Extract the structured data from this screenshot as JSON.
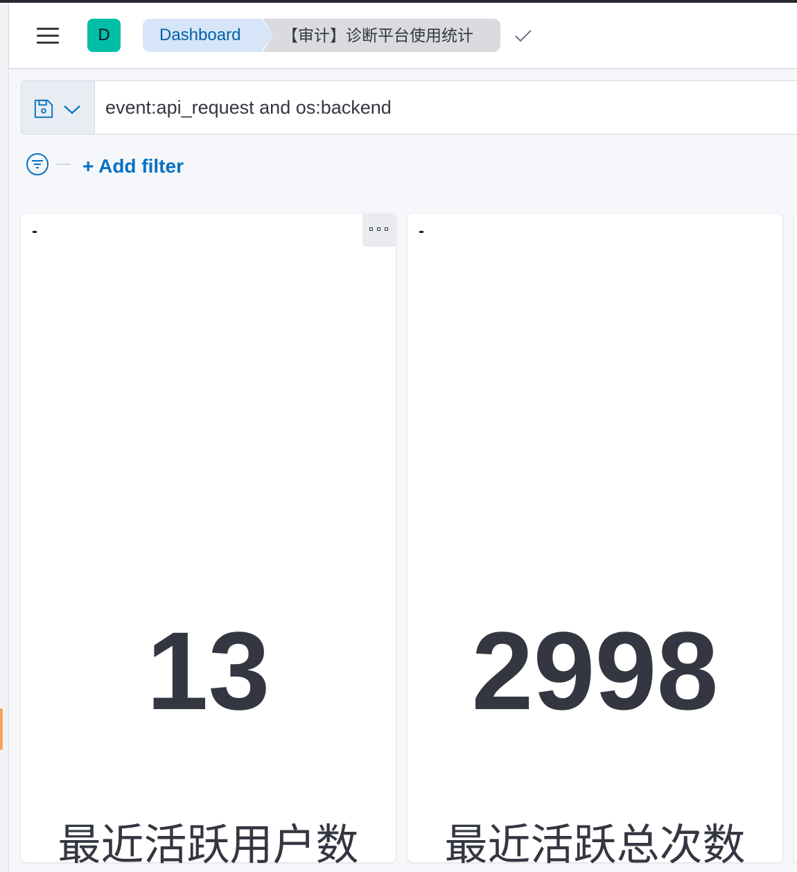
{
  "header": {
    "avatar_letter": "D",
    "breadcrumbs": [
      {
        "label": "Dashboard"
      },
      {
        "label": "【审计】诊断平台使用统计"
      }
    ]
  },
  "query": {
    "value": "event:api_request and os:backend"
  },
  "filters": {
    "add_label": "+ Add filter"
  },
  "panels": [
    {
      "title": "-",
      "value": "13",
      "label": "最近活跃用户数"
    },
    {
      "title": "-",
      "value": "2998",
      "label": "最近活跃总次数"
    }
  ],
  "colors": {
    "avatar": "#00bfa6",
    "link": "#0071c2",
    "breadcrumb_active_bg": "#d6e5f7",
    "breadcrumb_bg": "#d9dbdf",
    "metric_text": "#343741",
    "side_tab": "#f5a35c"
  }
}
